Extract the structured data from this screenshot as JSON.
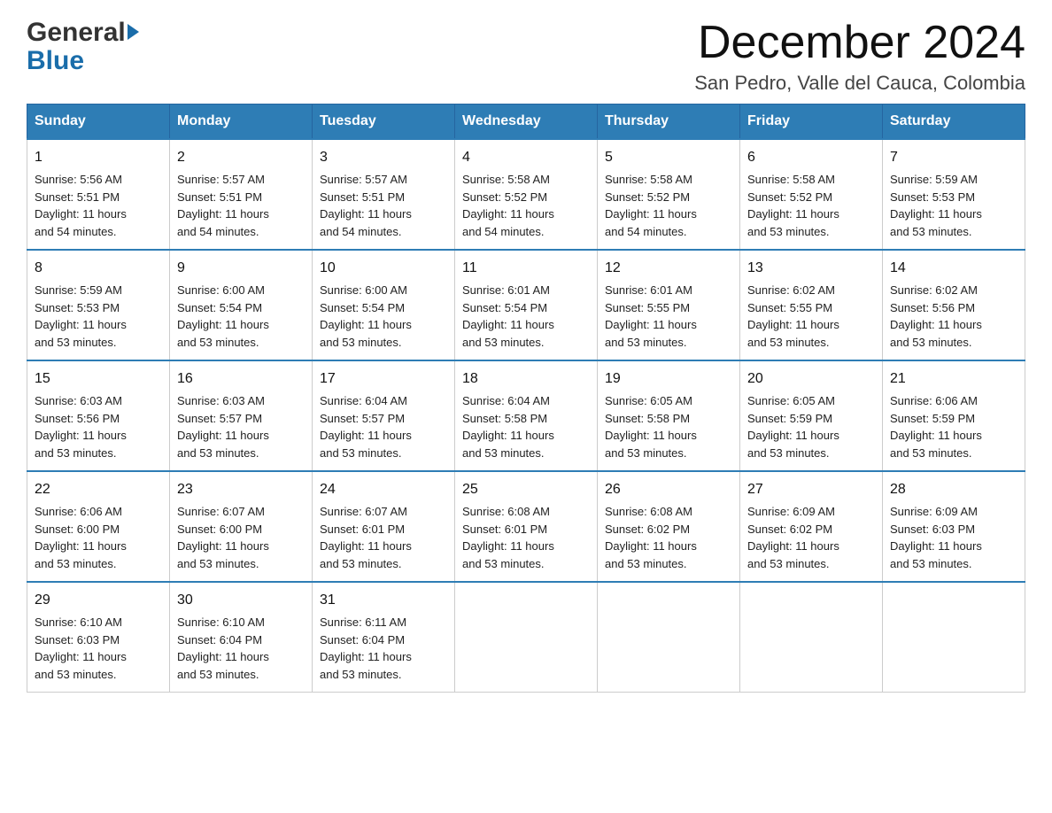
{
  "header": {
    "logo": {
      "general": "General",
      "blue": "Blue"
    },
    "title": "December 2024",
    "subtitle": "San Pedro, Valle del Cauca, Colombia"
  },
  "days_of_week": [
    "Sunday",
    "Monday",
    "Tuesday",
    "Wednesday",
    "Thursday",
    "Friday",
    "Saturday"
  ],
  "weeks": [
    [
      {
        "day": "1",
        "sunrise": "5:56 AM",
        "sunset": "5:51 PM",
        "daylight": "11 hours and 54 minutes."
      },
      {
        "day": "2",
        "sunrise": "5:57 AM",
        "sunset": "5:51 PM",
        "daylight": "11 hours and 54 minutes."
      },
      {
        "day": "3",
        "sunrise": "5:57 AM",
        "sunset": "5:51 PM",
        "daylight": "11 hours and 54 minutes."
      },
      {
        "day": "4",
        "sunrise": "5:58 AM",
        "sunset": "5:52 PM",
        "daylight": "11 hours and 54 minutes."
      },
      {
        "day": "5",
        "sunrise": "5:58 AM",
        "sunset": "5:52 PM",
        "daylight": "11 hours and 54 minutes."
      },
      {
        "day": "6",
        "sunrise": "5:58 AM",
        "sunset": "5:52 PM",
        "daylight": "11 hours and 53 minutes."
      },
      {
        "day": "7",
        "sunrise": "5:59 AM",
        "sunset": "5:53 PM",
        "daylight": "11 hours and 53 minutes."
      }
    ],
    [
      {
        "day": "8",
        "sunrise": "5:59 AM",
        "sunset": "5:53 PM",
        "daylight": "11 hours and 53 minutes."
      },
      {
        "day": "9",
        "sunrise": "6:00 AM",
        "sunset": "5:54 PM",
        "daylight": "11 hours and 53 minutes."
      },
      {
        "day": "10",
        "sunrise": "6:00 AM",
        "sunset": "5:54 PM",
        "daylight": "11 hours and 53 minutes."
      },
      {
        "day": "11",
        "sunrise": "6:01 AM",
        "sunset": "5:54 PM",
        "daylight": "11 hours and 53 minutes."
      },
      {
        "day": "12",
        "sunrise": "6:01 AM",
        "sunset": "5:55 PM",
        "daylight": "11 hours and 53 minutes."
      },
      {
        "day": "13",
        "sunrise": "6:02 AM",
        "sunset": "5:55 PM",
        "daylight": "11 hours and 53 minutes."
      },
      {
        "day": "14",
        "sunrise": "6:02 AM",
        "sunset": "5:56 PM",
        "daylight": "11 hours and 53 minutes."
      }
    ],
    [
      {
        "day": "15",
        "sunrise": "6:03 AM",
        "sunset": "5:56 PM",
        "daylight": "11 hours and 53 minutes."
      },
      {
        "day": "16",
        "sunrise": "6:03 AM",
        "sunset": "5:57 PM",
        "daylight": "11 hours and 53 minutes."
      },
      {
        "day": "17",
        "sunrise": "6:04 AM",
        "sunset": "5:57 PM",
        "daylight": "11 hours and 53 minutes."
      },
      {
        "day": "18",
        "sunrise": "6:04 AM",
        "sunset": "5:58 PM",
        "daylight": "11 hours and 53 minutes."
      },
      {
        "day": "19",
        "sunrise": "6:05 AM",
        "sunset": "5:58 PM",
        "daylight": "11 hours and 53 minutes."
      },
      {
        "day": "20",
        "sunrise": "6:05 AM",
        "sunset": "5:59 PM",
        "daylight": "11 hours and 53 minutes."
      },
      {
        "day": "21",
        "sunrise": "6:06 AM",
        "sunset": "5:59 PM",
        "daylight": "11 hours and 53 minutes."
      }
    ],
    [
      {
        "day": "22",
        "sunrise": "6:06 AM",
        "sunset": "6:00 PM",
        "daylight": "11 hours and 53 minutes."
      },
      {
        "day": "23",
        "sunrise": "6:07 AM",
        "sunset": "6:00 PM",
        "daylight": "11 hours and 53 minutes."
      },
      {
        "day": "24",
        "sunrise": "6:07 AM",
        "sunset": "6:01 PM",
        "daylight": "11 hours and 53 minutes."
      },
      {
        "day": "25",
        "sunrise": "6:08 AM",
        "sunset": "6:01 PM",
        "daylight": "11 hours and 53 minutes."
      },
      {
        "day": "26",
        "sunrise": "6:08 AM",
        "sunset": "6:02 PM",
        "daylight": "11 hours and 53 minutes."
      },
      {
        "day": "27",
        "sunrise": "6:09 AM",
        "sunset": "6:02 PM",
        "daylight": "11 hours and 53 minutes."
      },
      {
        "day": "28",
        "sunrise": "6:09 AM",
        "sunset": "6:03 PM",
        "daylight": "11 hours and 53 minutes."
      }
    ],
    [
      {
        "day": "29",
        "sunrise": "6:10 AM",
        "sunset": "6:03 PM",
        "daylight": "11 hours and 53 minutes."
      },
      {
        "day": "30",
        "sunrise": "6:10 AM",
        "sunset": "6:04 PM",
        "daylight": "11 hours and 53 minutes."
      },
      {
        "day": "31",
        "sunrise": "6:11 AM",
        "sunset": "6:04 PM",
        "daylight": "11 hours and 53 minutes."
      },
      null,
      null,
      null,
      null
    ]
  ],
  "labels": {
    "sunrise": "Sunrise:",
    "sunset": "Sunset:",
    "daylight": "Daylight:"
  },
  "colors": {
    "header_bg": "#2e7db5",
    "header_text": "#ffffff",
    "border_top": "#2e7db5"
  }
}
